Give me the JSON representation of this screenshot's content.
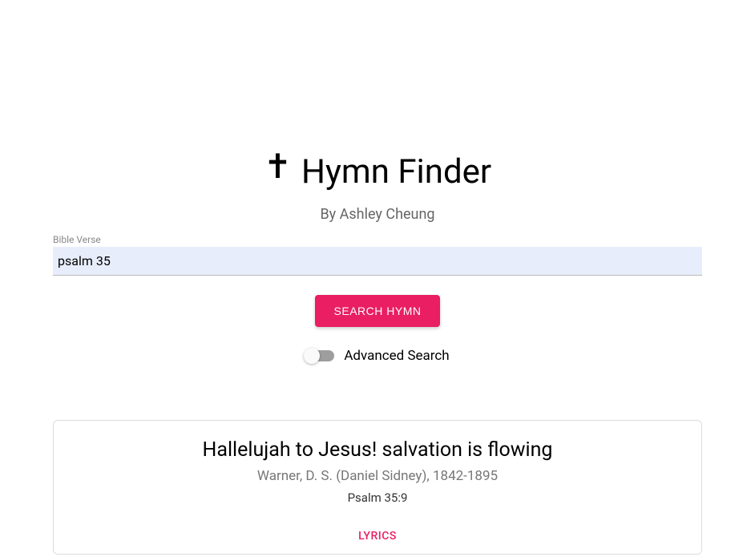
{
  "header": {
    "title": "Hymn Finder",
    "byline": "By Ashley Cheung",
    "cross_glyph": "✝"
  },
  "search": {
    "label": "Bible Verse",
    "value": "psalm 35",
    "button": "SEARCH HYMN"
  },
  "advanced": {
    "label": "Advanced Search",
    "enabled": false
  },
  "results": [
    {
      "title": "Hallelujah to Jesus! salvation is flowing",
      "author": "Warner, D. S. (Daniel Sidney), 1842-1895",
      "reference": "Psalm 35:9",
      "lyrics_label": "LYRICS"
    }
  ]
}
